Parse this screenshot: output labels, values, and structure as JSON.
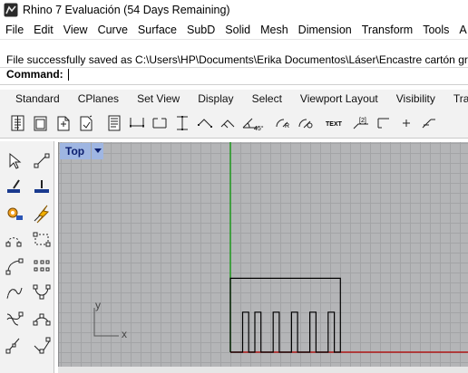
{
  "window": {
    "title": "Rhino 7 Evaluación (54 Days Remaining)"
  },
  "menu": [
    {
      "label": "File",
      "name": "menu-file"
    },
    {
      "label": "Edit",
      "name": "menu-edit"
    },
    {
      "label": "View",
      "name": "menu-view"
    },
    {
      "label": "Curve",
      "name": "menu-curve"
    },
    {
      "label": "Surface",
      "name": "menu-surface"
    },
    {
      "label": "SubD",
      "name": "menu-subd"
    },
    {
      "label": "Solid",
      "name": "menu-solid"
    },
    {
      "label": "Mesh",
      "name": "menu-mesh"
    },
    {
      "label": "Dimension",
      "name": "menu-dimension"
    },
    {
      "label": "Transform",
      "name": "menu-transform"
    },
    {
      "label": "Tools",
      "name": "menu-tools"
    },
    {
      "label": "A",
      "name": "menu-analyze"
    }
  ],
  "command": {
    "history": "File successfully saved as C:\\Users\\HP\\Documents\\Erika Documentos\\Láser\\Encastre cartón gris.",
    "prompt": "Command:",
    "value": ""
  },
  "tabs": [
    {
      "label": "Standard",
      "name": "tab-standard"
    },
    {
      "label": "CPlanes",
      "name": "tab-cplanes"
    },
    {
      "label": "Set View",
      "name": "tab-set-view"
    },
    {
      "label": "Display",
      "name": "tab-display"
    },
    {
      "label": "Select",
      "name": "tab-select"
    },
    {
      "label": "Viewport Layout",
      "name": "tab-viewport-layout"
    },
    {
      "label": "Visibility",
      "name": "tab-visibility"
    },
    {
      "label": "Tran",
      "name": "tab-transform"
    }
  ],
  "toolbar_icons": [
    "new-file-icon",
    "new-template-icon",
    "open-file-icon",
    "save-icon",
    "print-icon",
    "dimension-linear-icon",
    "dimension-aligned-icon",
    "dimension-vertical-icon",
    "dimension-rotated-icon",
    "dimension-ordinate-icon",
    "dimension-angle-icon",
    "dimension-radius-icon",
    "dimension-diameter-icon",
    "text-icon",
    "leader-icon",
    "point-icon",
    "arrow-icon"
  ],
  "toolbar_text_labels": {
    "text": "TEXT",
    "leader": "[2]",
    "angle": "45°"
  },
  "left_tools": [
    [
      "select-arrow-icon",
      "point-cloud-icon"
    ],
    [
      "analyze-direction-icon",
      "analyze-normal-icon"
    ],
    [
      "gear-settings-icon",
      "lightning-icon"
    ],
    [
      "curve-from-object-icon",
      "rectangle-dashed-icon"
    ],
    [
      "arc-curve-icon",
      "control-points-icon"
    ],
    [
      "interpolate-curve-icon",
      "curve-sketch-icon"
    ],
    [
      "polyline-icon",
      "curve-blend-icon"
    ],
    [
      "line-icon",
      "curve-tangent-icon"
    ]
  ],
  "viewport": {
    "name": "Top",
    "dropdown_icon": "chevron-down-icon",
    "axis_x_label": "x",
    "axis_y_label": "y"
  },
  "colors": {
    "grid_bg": "#b4b5b7",
    "grid_line": "#a3a4a6",
    "x_axis": "#b01717",
    "y_axis": "#1f9a1f",
    "viewport_title_bg": "#9fb6e2",
    "viewport_title_text": "#0b1e6e"
  },
  "geometry": {
    "outline_points": [
      [
        0.0,
        0.0
      ],
      [
        0.0,
        24.0
      ],
      [
        36.0,
        24.0
      ],
      [
        36.0,
        0.0
      ],
      [
        34.0,
        0.0
      ],
      [
        34.0,
        13.0
      ],
      [
        32.0,
        13.0
      ],
      [
        32.0,
        0.0
      ],
      [
        28.0,
        0.0
      ],
      [
        28.0,
        13.0
      ],
      [
        26.0,
        13.0
      ],
      [
        26.0,
        0.0
      ],
      [
        22.0,
        0.0
      ],
      [
        22.0,
        13.0
      ],
      [
        20.0,
        13.0
      ],
      [
        20.0,
        0.0
      ],
      [
        16.0,
        0.0
      ],
      [
        16.0,
        13.0
      ],
      [
        14.0,
        13.0
      ],
      [
        14.0,
        0.0
      ],
      [
        10.0,
        0.0
      ],
      [
        10.0,
        13.0
      ],
      [
        8.0,
        13.0
      ],
      [
        8.0,
        0.0
      ],
      [
        6.0,
        0.0
      ],
      [
        6.0,
        13.0
      ],
      [
        4.0,
        13.0
      ],
      [
        4.0,
        0.0
      ]
    ]
  }
}
